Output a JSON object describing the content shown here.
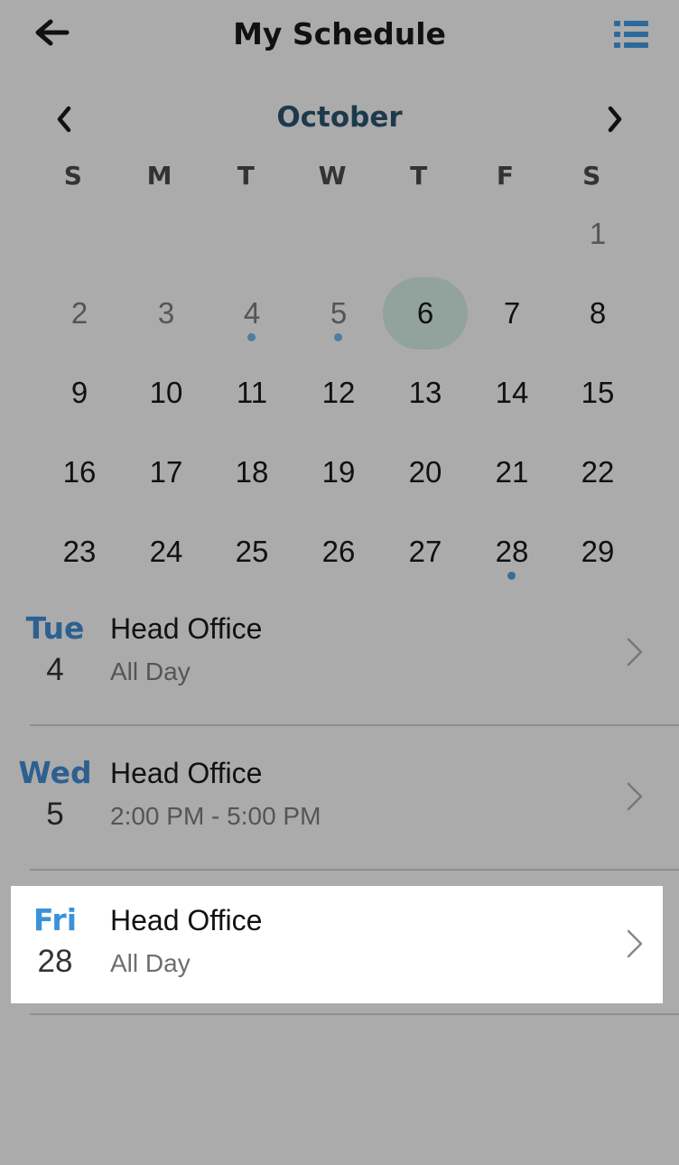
{
  "header": {
    "title": "My Schedule",
    "back_icon": "arrow-left-icon",
    "menu_icon": "list-icon"
  },
  "calendar": {
    "month": "October",
    "weekdays": [
      "S",
      "M",
      "T",
      "W",
      "T",
      "F",
      "S"
    ],
    "selected_day": "6",
    "days_with_events": [
      "4",
      "5",
      "28"
    ],
    "weeks": [
      [
        "",
        "",
        "",
        "",
        "",
        "",
        "1"
      ],
      [
        "2",
        "3",
        "4",
        "5",
        "6",
        "7",
        "8"
      ],
      [
        "9",
        "10",
        "11",
        "12",
        "13",
        "14",
        "15"
      ],
      [
        "16",
        "17",
        "18",
        "19",
        "20",
        "21",
        "22"
      ],
      [
        "23",
        "24",
        "25",
        "26",
        "27",
        "28",
        "29"
      ]
    ]
  },
  "events": [
    {
      "dow": "Tue",
      "date": "4",
      "title": "Head Office",
      "time": "All Day"
    },
    {
      "dow": "Wed",
      "date": "5",
      "title": "Head Office",
      "time": "2:00 PM - 5:00 PM"
    },
    {
      "dow": "Fri",
      "date": "28",
      "title": "Head Office",
      "time": "All Day"
    }
  ],
  "colors": {
    "background": "#ababab",
    "accent": "#2d6090",
    "highlight_accent": "#3a92da",
    "selected_day": "#92a29c"
  }
}
